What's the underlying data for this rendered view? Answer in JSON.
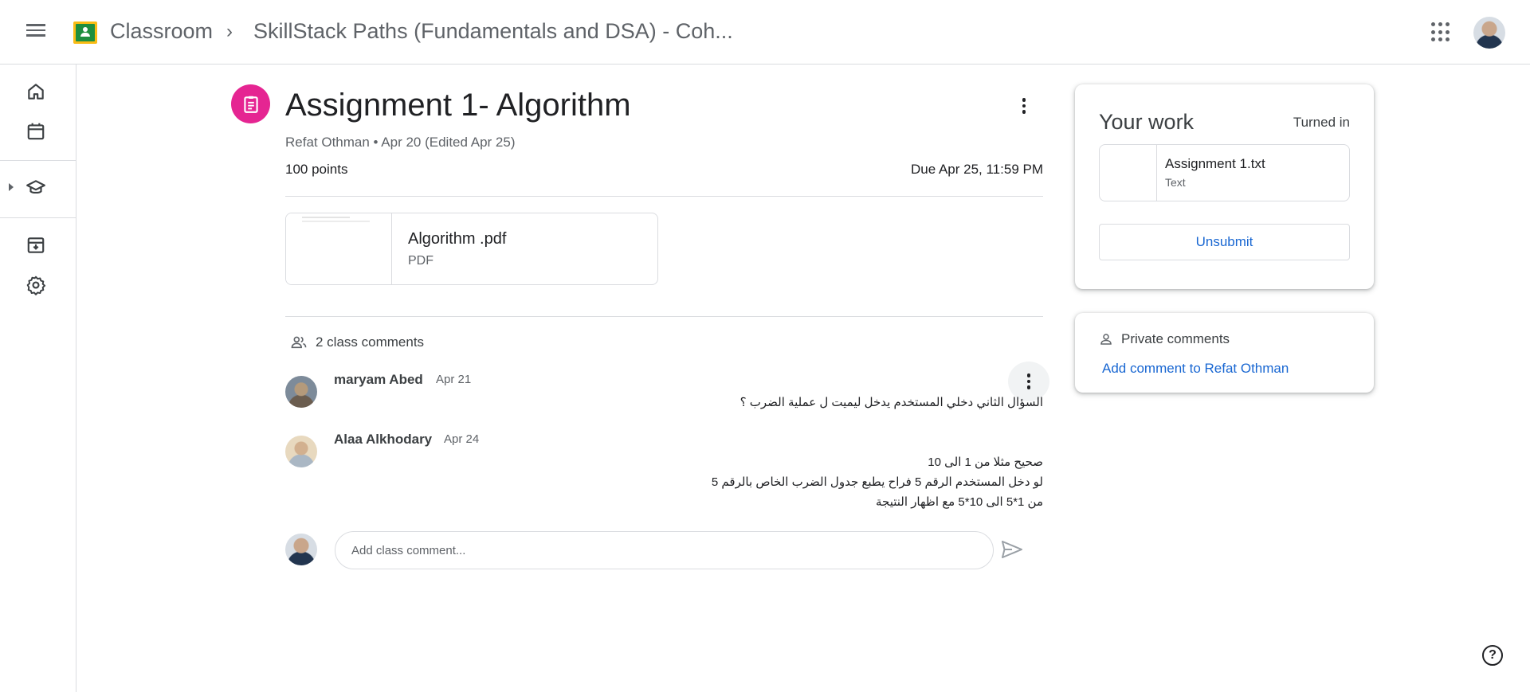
{
  "header": {
    "app_title": "Classroom",
    "breadcrumb_separator": "›",
    "class_title": "SkillStack Paths (Fundamentals and DSA) - Coh..."
  },
  "sidebar": {
    "items": [
      {
        "icon": "home-icon"
      },
      {
        "icon": "calendar-icon"
      },
      {
        "icon": "enrolled-classes-icon"
      },
      {
        "icon": "archive-icon"
      },
      {
        "icon": "settings-icon"
      }
    ]
  },
  "assignment": {
    "title": "Assignment 1- Algorithm",
    "meta": "Refat Othman • Apr 20 (Edited Apr 25)",
    "points": "100 points",
    "due": "Due Apr 25, 11:59 PM",
    "attachment": {
      "name": "Algorithm .pdf",
      "type": "PDF"
    }
  },
  "comments": {
    "header": "2 class comments",
    "items": [
      {
        "author": "maryam Abed",
        "date": "Apr 21",
        "lines": [
          "السؤال الثاني دخلي المستخدم يدخل ليميت ل عملية الضرب ؟"
        ]
      },
      {
        "author": "Alaa Alkhodary",
        "date": "Apr 24",
        "lines": [
          "صحيح مثلا من 1 الى 10",
          "لو دخل المستخدم الرقم 5 فراح يطبع جدول الضرب الخاص بالرقم 5",
          "من 1*5 الى 10*5 مع اظهار النتيجة"
        ]
      }
    ],
    "input_placeholder": "Add class comment..."
  },
  "your_work": {
    "title": "Your work",
    "status": "Turned in",
    "file": {
      "name": "Assignment 1.txt",
      "type": "Text"
    },
    "unsubmit_label": "Unsubmit"
  },
  "private_comments": {
    "header": "Private comments",
    "add_link": "Add comment to Refat Othman"
  },
  "colors": {
    "accent": "#1967d2",
    "assignment_icon_bg": "#e52592",
    "logo_green": "#1e8e3e",
    "logo_yellow": "#f9bc15"
  },
  "help_label": "?"
}
